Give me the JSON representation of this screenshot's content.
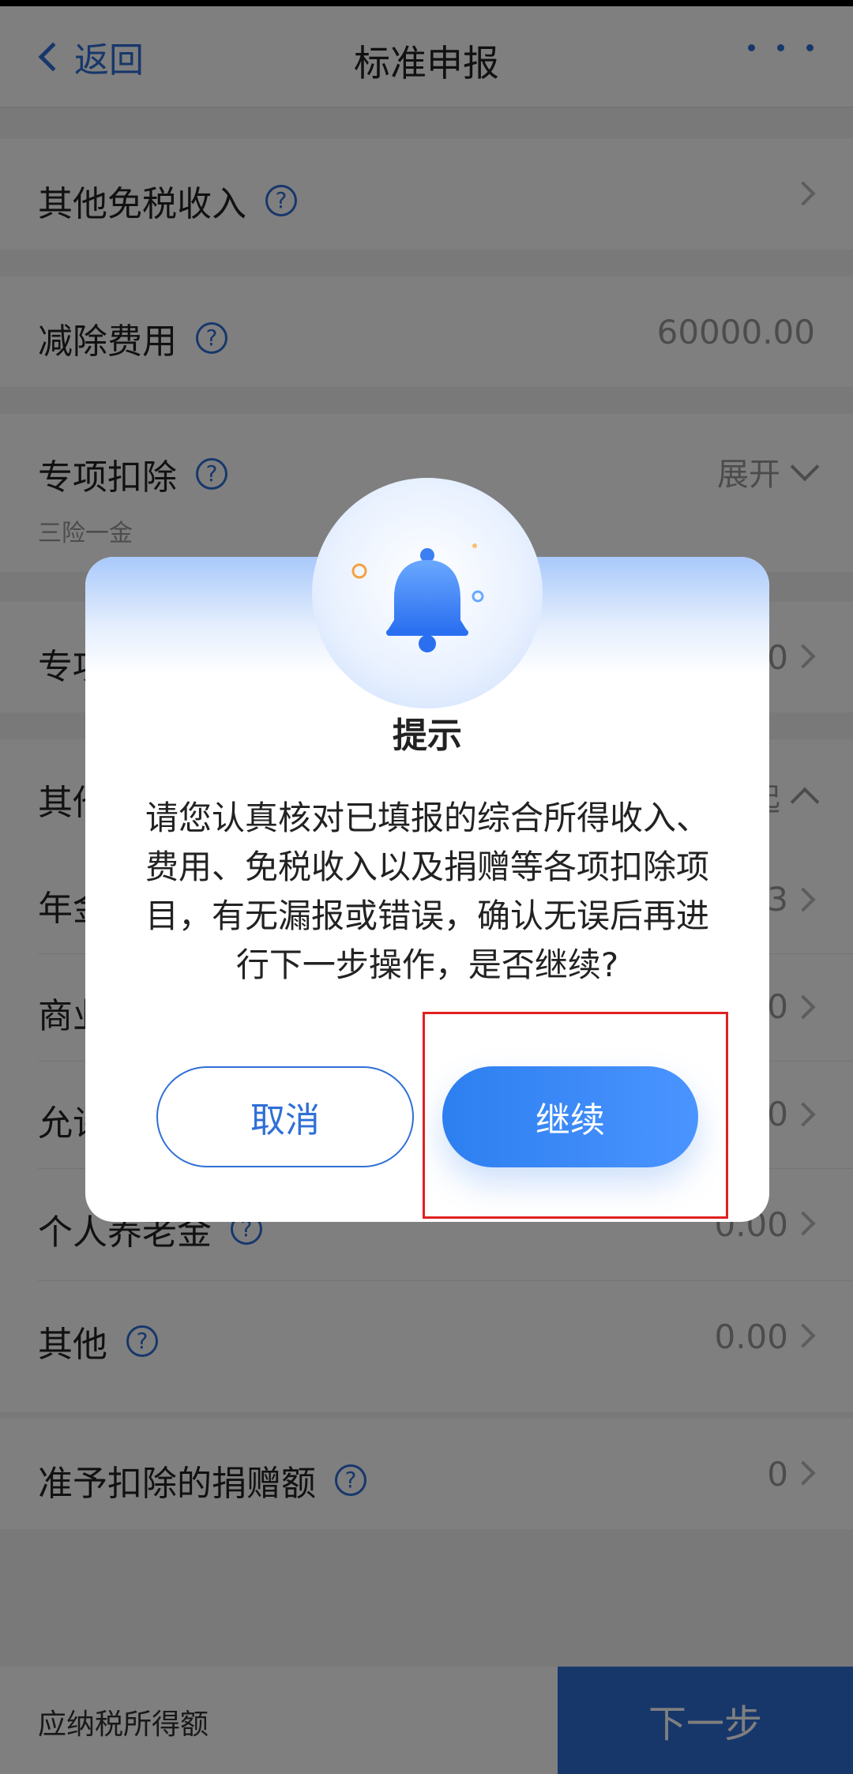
{
  "nav": {
    "back_label": "返回",
    "title": "标准申报"
  },
  "rows": {
    "other_tax_free_income": {
      "label": "其他免税收入"
    },
    "deduction_expense": {
      "label": "减除费用",
      "value": "60000.00"
    },
    "special_deduction": {
      "label": "专项扣除",
      "expand_label": "展开",
      "sub": "三险一金"
    },
    "special_additional": {
      "label_partial": "专项",
      "value_partial": "0"
    },
    "other_section": {
      "label_partial": "其他",
      "value_partial": "起"
    },
    "annuity": {
      "label_partial": "年金",
      "value_partial": "3"
    },
    "commercial": {
      "label_partial": "商业",
      "value_partial": "0"
    },
    "allowed": {
      "label_partial": "允许",
      "value_partial": "0"
    },
    "personal_pension": {
      "label": "个人养老金",
      "value": "0.00"
    },
    "others": {
      "label": "其他",
      "value": "0.00"
    },
    "donation": {
      "label": "准予扣除的捐赠额",
      "value": "0"
    }
  },
  "bottom": {
    "label": "应纳税所得额",
    "next_label": "下一步"
  },
  "dialog": {
    "title": "提示",
    "message": "请您认真核对已填报的综合所得收入、费用、免税收入以及捐赠等各项扣除项目，有无漏报或错误，确认无误后再进行下一步操作，是否继续?",
    "cancel_label": "取消",
    "continue_label": "继续"
  },
  "colors": {
    "accent": "#2f6fd6",
    "highlight_box": "#e02020"
  }
}
